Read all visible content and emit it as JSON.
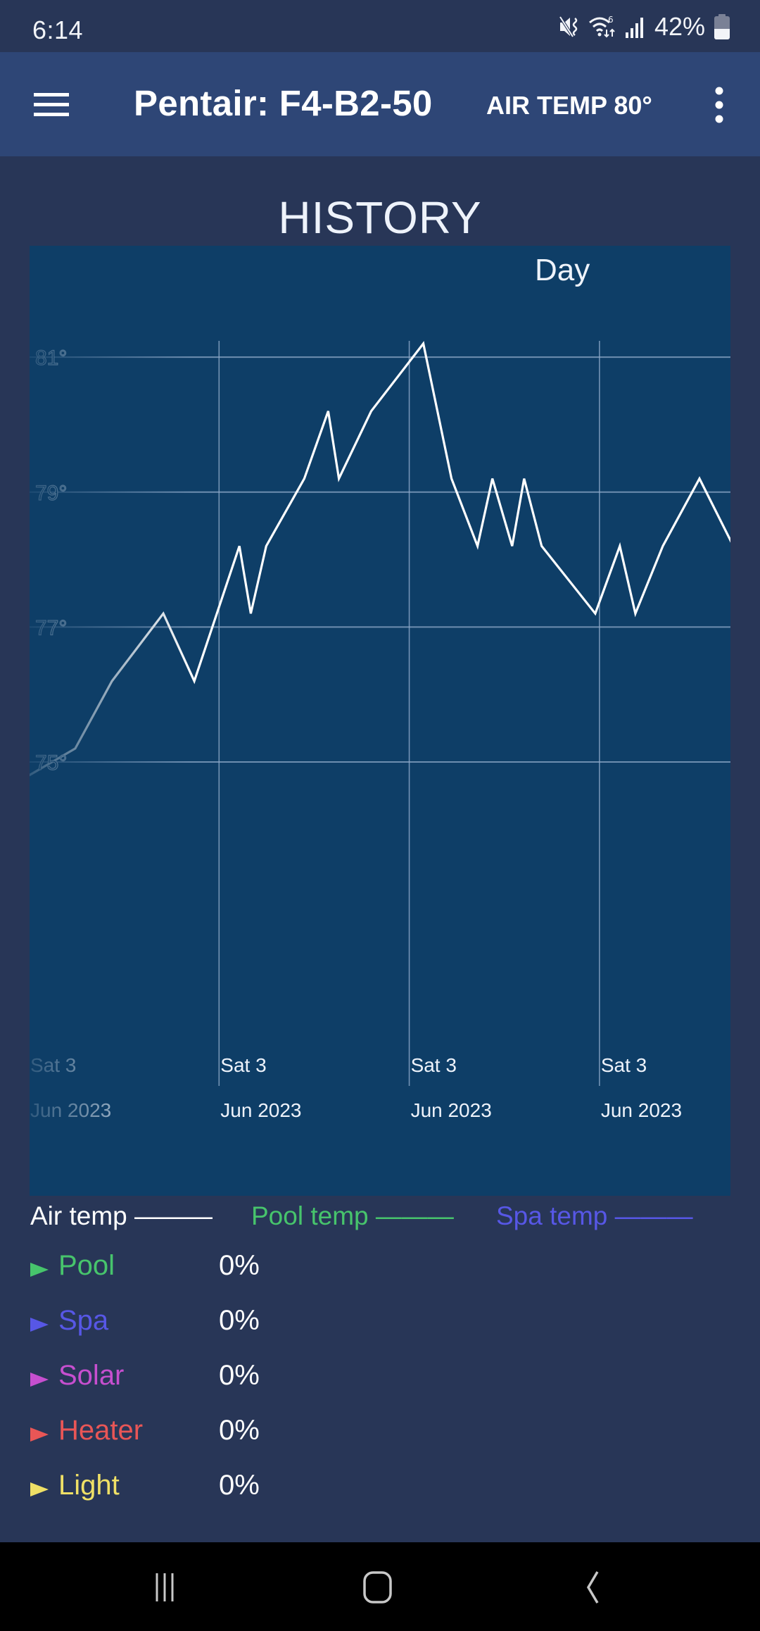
{
  "status_bar": {
    "time": "6:14",
    "icons": [
      "mute-vibrate-icon",
      "wifi-6-icon",
      "signal-icon",
      "battery-icon"
    ],
    "battery_percent": "42%"
  },
  "app_bar": {
    "menu_icon": "hamburger-menu-icon",
    "title": "Pentair: F4-B2-50",
    "air_temp": "AIR TEMP 80°",
    "more_icon": "more-vertical-icon"
  },
  "history": {
    "title": "HISTORY",
    "period": "Day"
  },
  "colors": {
    "air": "#ffffff",
    "pool": "#47c46c",
    "spa": "#5757e6",
    "solar": "#c64fcf",
    "heater": "#e95656",
    "light": "#efe066"
  },
  "chart_data": {
    "type": "line",
    "title": "HISTORY",
    "period": "Day",
    "xlabel": "",
    "ylabel": "",
    "x_unit": "tick intervals (each vertical gridline = one labelled tick)",
    "xlim": [
      0,
      3.685
    ],
    "ylim": [
      70.2,
      82.65
    ],
    "grid": true,
    "yticks": [
      75,
      77,
      79,
      81
    ],
    "ytick_labels": [
      "75°",
      "77°",
      "79°",
      "81°"
    ],
    "xticks": [
      0,
      1,
      2,
      3
    ],
    "xtick_labels": [
      {
        "line1": "Sat 3",
        "line2": "Jun 2023"
      },
      {
        "line1": "Sat 3",
        "line2": "Jun 2023"
      },
      {
        "line1": "Sat 3",
        "line2": "Jun 2023"
      },
      {
        "line1": "Sat 3",
        "line2": "Jun 2023"
      }
    ],
    "legend": [
      {
        "name": "Air temp",
        "swatch": "———",
        "color": "#ffffff"
      },
      {
        "name": "Pool temp",
        "swatch": "———",
        "color": "#47c46c"
      },
      {
        "name": "Spa temp",
        "swatch": "———",
        "color": "#5757e6"
      }
    ],
    "legend_position": "bottom",
    "series": [
      {
        "name": "Air temp",
        "color": "#ffffff",
        "x": [
          0.0,
          0.244,
          0.437,
          0.707,
          0.87,
          1.107,
          1.167,
          1.248,
          1.448,
          1.574,
          1.63,
          1.8,
          2.074,
          2.222,
          2.359,
          2.437,
          2.541,
          2.604,
          2.696,
          2.978,
          3.107,
          3.189,
          3.333,
          3.526,
          3.704
        ],
        "y": [
          74.8,
          75.2,
          76.2,
          77.2,
          76.2,
          78.2,
          77.2,
          78.2,
          79.2,
          80.2,
          79.2,
          80.2,
          81.2,
          79.2,
          78.2,
          79.2,
          78.2,
          79.2,
          78.2,
          77.2,
          78.2,
          77.2,
          78.2,
          79.2,
          78.2
        ]
      }
    ]
  },
  "equipment": [
    {
      "name": "Pool",
      "value": "0%",
      "color_key": "pool"
    },
    {
      "name": "Spa",
      "value": "0%",
      "color_key": "spa"
    },
    {
      "name": "Solar",
      "value": "0%",
      "color_key": "solar"
    },
    {
      "name": "Heater",
      "value": "0%",
      "color_key": "heater"
    },
    {
      "name": "Light",
      "value": "0%",
      "color_key": "light"
    }
  ],
  "nav_bar": {
    "recents_icon": "recents-icon",
    "home_icon": "home-icon",
    "back_icon": "back-icon"
  }
}
